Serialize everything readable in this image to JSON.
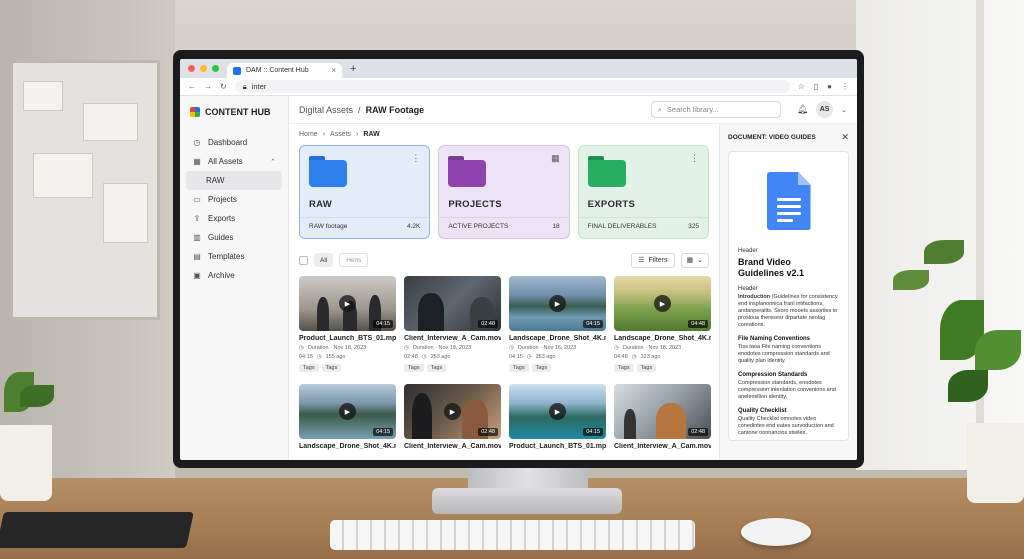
{
  "browser": {
    "tab_title": "DAM :: Content Hub",
    "tab_close": "×",
    "new_tab": "+",
    "url": "inter"
  },
  "sidebar": {
    "brand": "CONTENT HUB",
    "items": [
      {
        "label": "Dashboard"
      },
      {
        "label": "All Assets"
      },
      {
        "label": "RAW"
      },
      {
        "label": "Projects"
      },
      {
        "label": "Exports"
      },
      {
        "label": "Guides"
      },
      {
        "label": "Templates"
      },
      {
        "label": "Archive"
      }
    ]
  },
  "header": {
    "title_parent": "Digital Assets",
    "title_sep": "/",
    "title_current": "RAW Footage",
    "search_placeholder": "Search library...",
    "avatar": "AS"
  },
  "breadcrumb": [
    "Home",
    "Assets",
    "RAW"
  ],
  "folders": [
    {
      "title": "RAW",
      "desc": "RAW footage",
      "count": "4.2K",
      "color": "#2f80ed"
    },
    {
      "title": "PROJECTS",
      "desc": "ACTIVE PROJECTS",
      "count": "18",
      "color": "#8e44ad"
    },
    {
      "title": "EXPORTS",
      "desc": "FINAL DELIVERABLES",
      "count": "325",
      "color": "#27ae60"
    }
  ],
  "toolbar": {
    "all": "All",
    "items": "Hens",
    "filters": "Filters"
  },
  "assets": [
    {
      "name": "Product_Launch_BTS_01.mp4",
      "meta1": "Duration · Nov 18, 2023",
      "dur": "04:15",
      "ago": "155 ago",
      "tags": [
        "Tags",
        "Tags"
      ]
    },
    {
      "name": "Client_Interview_A_Cam.mov",
      "meta1": "Duration · Nov 18, 2023",
      "dur": "02:48",
      "ago": "253 ago",
      "tags": [
        "Tags",
        "Tags"
      ]
    },
    {
      "name": "Landscape_Drone_Shot_4K.mp4",
      "meta1": "Duration · Nov 16, 2023",
      "dur": "04:15",
      "ago": "253 ago",
      "tags": [
        "Tags",
        "Tags"
      ]
    },
    {
      "name": "Landscape_Drone_Shot_4K.mp4",
      "meta1": "Duration · Nov 18, 2023",
      "dur": "04:48",
      "ago": "323 ago",
      "tags": [
        "Tags",
        "Tags"
      ]
    },
    {
      "name": "Landscape_Drone_Shot_4K.mp4",
      "meta1": "",
      "dur": "04:15",
      "ago": "",
      "tags": []
    },
    {
      "name": "Client_Interview_A_Cam.mov",
      "meta1": "",
      "dur": "02:48",
      "ago": "",
      "tags": []
    },
    {
      "name": "Product_Launch_BTS_01.mp4",
      "meta1": "",
      "dur": "04:15",
      "ago": "",
      "tags": []
    },
    {
      "name": "Client_Interview_A_Cam.mov",
      "meta1": "",
      "dur": "02:48",
      "ago": "",
      "tags": []
    }
  ],
  "doc": {
    "panel_title": "DOCUMENT: VIDEO GUIDES",
    "label1": "Header",
    "title": "Brand Video Guidelines v2.1",
    "label2": "Header",
    "intro_head": "Introduction",
    "intro_text": "(Guidelines for consistency end insplanonnica franl intifactions, andanperalits. Sxoro mooets assoriles to prosloua theresesr drpartate neolag coreations.",
    "s1_head": "File Naming Conventions",
    "s1_text": "Tiss taoa File naming conventions enodotes compression standards and quality plan identity.",
    "s2_head": "Compression Standards",
    "s2_text": "Compression standards, enodotes compression intenlation convenions and aneleosllion identity.",
    "s3_head": "Quality Checklist",
    "s3_text": "Quality Checklist omnotes video conedintes end eates survoduction and cantone oonnancios stwiles."
  }
}
